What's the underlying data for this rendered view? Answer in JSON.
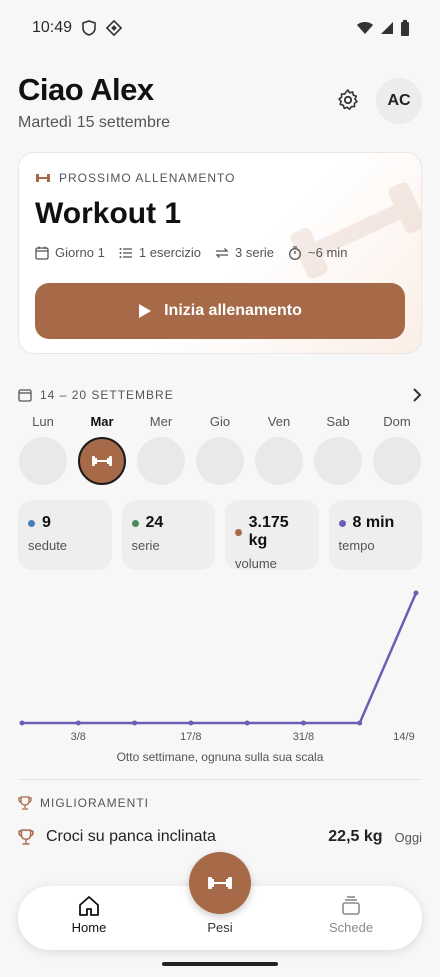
{
  "status_bar": {
    "time": "10:49"
  },
  "header": {
    "greeting": "Ciao Alex",
    "date": "Martedì 15 settembre",
    "avatar": "AC",
    "settings_icon": "gear-icon"
  },
  "next_workout": {
    "label": "PROSSIMO ALLENAMENTO",
    "title": "Workout 1",
    "day": "Giorno 1",
    "exercises": "1 esercizio",
    "sets": "3 serie",
    "duration": "~6 min",
    "start_label": "Inizia allenamento",
    "accent": "#a76a48"
  },
  "week": {
    "range": "14 – 20 SETTEMBRE",
    "days": [
      {
        "label": "Lun",
        "active": false
      },
      {
        "label": "Mar",
        "active": true
      },
      {
        "label": "Mer",
        "active": false
      },
      {
        "label": "Gio",
        "active": false
      },
      {
        "label": "Ven",
        "active": false
      },
      {
        "label": "Sab",
        "active": false
      },
      {
        "label": "Dom",
        "active": false
      }
    ]
  },
  "stats": [
    {
      "value": "9",
      "label": "sedute",
      "color": "#4a7fb5"
    },
    {
      "value": "24",
      "label": "serie",
      "color": "#4a8a5a"
    },
    {
      "value": "3.175 kg",
      "label": "volume",
      "color": "#a76a48"
    },
    {
      "value": "8 min",
      "label": "tempo",
      "color": "#6b5fb5"
    }
  ],
  "chart_data": {
    "type": "line",
    "x": [
      "",
      "3/8",
      "",
      "17/8",
      "",
      "31/8",
      "",
      "14/9"
    ],
    "series": [
      {
        "values": [
          0,
          0,
          0,
          0,
          0,
          0,
          0,
          1
        ],
        "color": "#6b5fb5"
      }
    ],
    "caption": "Otto settimane, ognuna sulla sua scala",
    "ylim": [
      0,
      1
    ]
  },
  "improvements": {
    "label": "MIGLIORAMENTI",
    "items": [
      {
        "name": "Croci su panca inclinata",
        "value": "22,5 kg",
        "when": "Oggi"
      }
    ]
  },
  "nav": {
    "home": "Home",
    "weights": "Pesi",
    "plans": "Schede"
  }
}
